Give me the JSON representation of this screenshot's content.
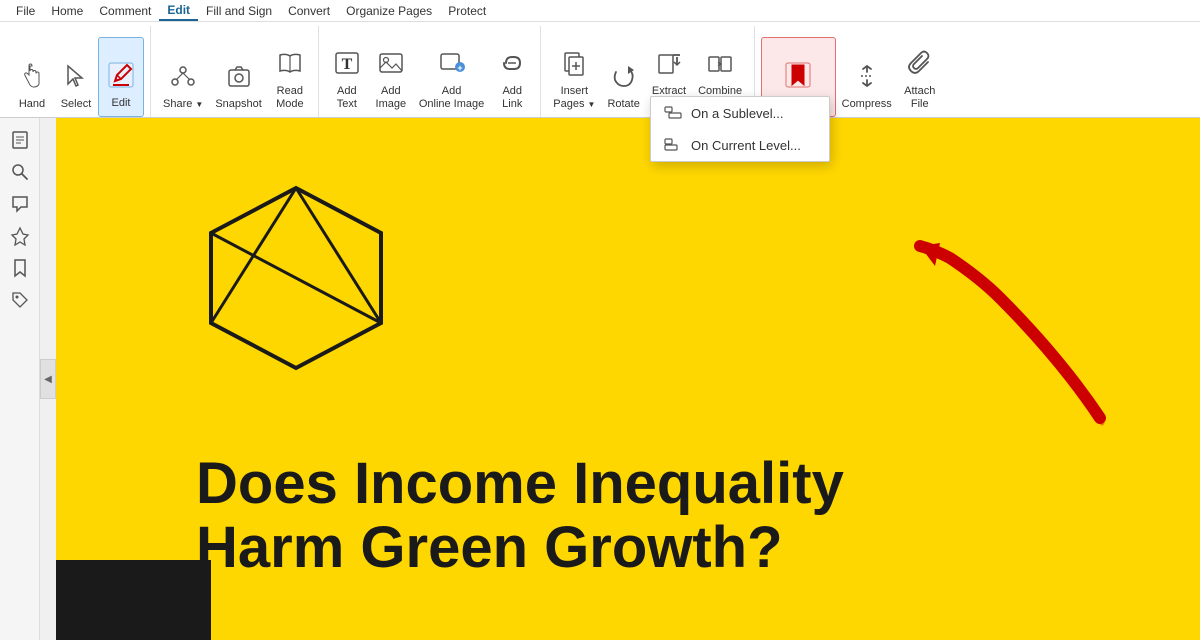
{
  "menubar": {
    "items": [
      "File",
      "Home",
      "Comment",
      "Edit",
      "Fill and Sign",
      "Convert",
      "Organize Pages",
      "Protect"
    ],
    "active": "Edit"
  },
  "ribbon": {
    "groups": [
      {
        "buttons": [
          {
            "id": "hand",
            "label": "Hand",
            "icon": "✋"
          },
          {
            "id": "select",
            "label": "Select",
            "icon": "↖"
          },
          {
            "id": "edit",
            "label": "Edit",
            "icon": "✏️",
            "active": true
          }
        ]
      },
      {
        "buttons": [
          {
            "id": "share",
            "label": "Share",
            "icon": "⬆",
            "has_arrow": true
          },
          {
            "id": "snapshot",
            "label": "Snapshot",
            "icon": "📷"
          },
          {
            "id": "read-mode",
            "label": "Read\nMode",
            "icon": "📖"
          }
        ]
      },
      {
        "buttons": [
          {
            "id": "add-text",
            "label": "Add\nText",
            "icon": "T"
          },
          {
            "id": "add-image",
            "label": "Add\nImage",
            "icon": "🖼"
          },
          {
            "id": "add-online-image",
            "label": "Add\nOnline Image",
            "icon": "🌐"
          },
          {
            "id": "add-link",
            "label": "Add\nLink",
            "icon": "🔗"
          }
        ]
      },
      {
        "buttons": [
          {
            "id": "insert-pages",
            "label": "Insert\nPages",
            "icon": "📄",
            "has_arrow": true
          },
          {
            "id": "rotate",
            "label": "Rotate",
            "icon": "🔄"
          },
          {
            "id": "extract-pages",
            "label": "Extract\nPages",
            "icon": "📤"
          },
          {
            "id": "combine-files",
            "label": "Combine\nFiles",
            "icon": "📑"
          }
        ]
      },
      {
        "buttons": [
          {
            "id": "bookmark",
            "label": "Bookmark",
            "icon": "🔖",
            "has_arrow": true,
            "highlighted": true
          },
          {
            "id": "compress",
            "label": "Compress",
            "icon": "🗜"
          },
          {
            "id": "attach-file",
            "label": "Attach\nFile",
            "icon": "📎"
          }
        ]
      }
    ]
  },
  "dropdown": {
    "items": [
      {
        "id": "sublevel",
        "label": "On a Sublevel..."
      },
      {
        "id": "current-level",
        "label": "On Current Level..."
      }
    ]
  },
  "sidebar": {
    "icons": [
      "📄",
      "🔍",
      "💬",
      "📌",
      "🔖",
      "🏷"
    ]
  },
  "document": {
    "title_line1": "Does Income Inequality",
    "title_line2": "Harm Green Growth?"
  }
}
